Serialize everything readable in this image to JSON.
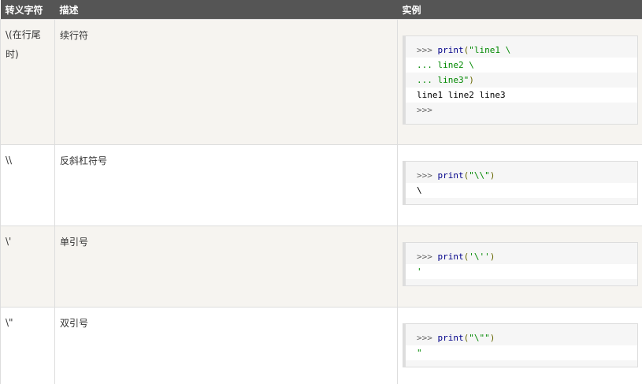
{
  "header": {
    "col_char": "转义字符",
    "col_desc": "描述",
    "col_example": "实例"
  },
  "rows": [
    {
      "char": "\\(在行尾时)",
      "desc": "续行符",
      "code": [
        {
          "prompt": ">>> ",
          "fn": "print",
          "open": "(",
          "str": "\"line1 \\",
          "close": ""
        },
        {
          "prompt": "",
          "fn": "",
          "open": "",
          "str": "... line2 \\",
          "close": ""
        },
        {
          "prompt": "",
          "fn": "",
          "open": "",
          "str": "... line3\"",
          "close": ")"
        },
        {
          "out": "line1 line2 line3"
        },
        {
          "prompt": ">>>"
        }
      ]
    },
    {
      "char": "\\\\",
      "desc": "反斜杠符号",
      "code": [
        {
          "prompt": ">>> ",
          "fn": "print",
          "open": "(",
          "str": "\"\\\\\"",
          "close": ")"
        },
        {
          "out": "\\"
        }
      ]
    },
    {
      "char": "\\'",
      "desc": "单引号",
      "code": [
        {
          "prompt": ">>> ",
          "fn": "print",
          "open": "(",
          "str": "'\\''",
          "close": ")"
        },
        {
          "out": "'"
        }
      ]
    },
    {
      "char": "\\\"",
      "desc": "双引号",
      "code": [
        {
          "prompt": ">>> ",
          "fn": "print",
          "open": "(",
          "str": "\"\\\"\"",
          "close": ")"
        },
        {
          "out": "\""
        }
      ]
    }
  ]
}
